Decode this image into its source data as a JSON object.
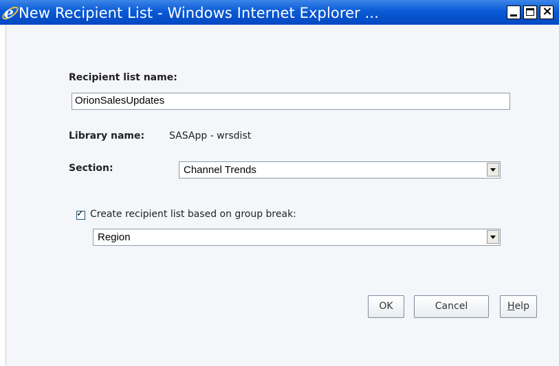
{
  "window": {
    "title": "New Recipient List - Windows Internet Explorer ...",
    "controls": [
      "minimize",
      "maximize",
      "close"
    ]
  },
  "form": {
    "recipient_list_name_label": "Recipient list name:",
    "recipient_list_name_value": "OrionSalesUpdates",
    "library_name_label": "Library name:",
    "library_name_value": "SASApp - wrsdist",
    "section_label": "Section:",
    "section_value": "Channel Trends",
    "group_break_checkbox_label": "Create recipient list based on group break:",
    "group_break_checked": true,
    "group_break_value": "Region"
  },
  "buttons": {
    "ok": "OK",
    "cancel": "Cancel",
    "help_mnemonic": "H",
    "help_rest": "elp"
  },
  "colors": {
    "titlebar": "#0a5ad6",
    "client_background": "#f4f6f9"
  }
}
